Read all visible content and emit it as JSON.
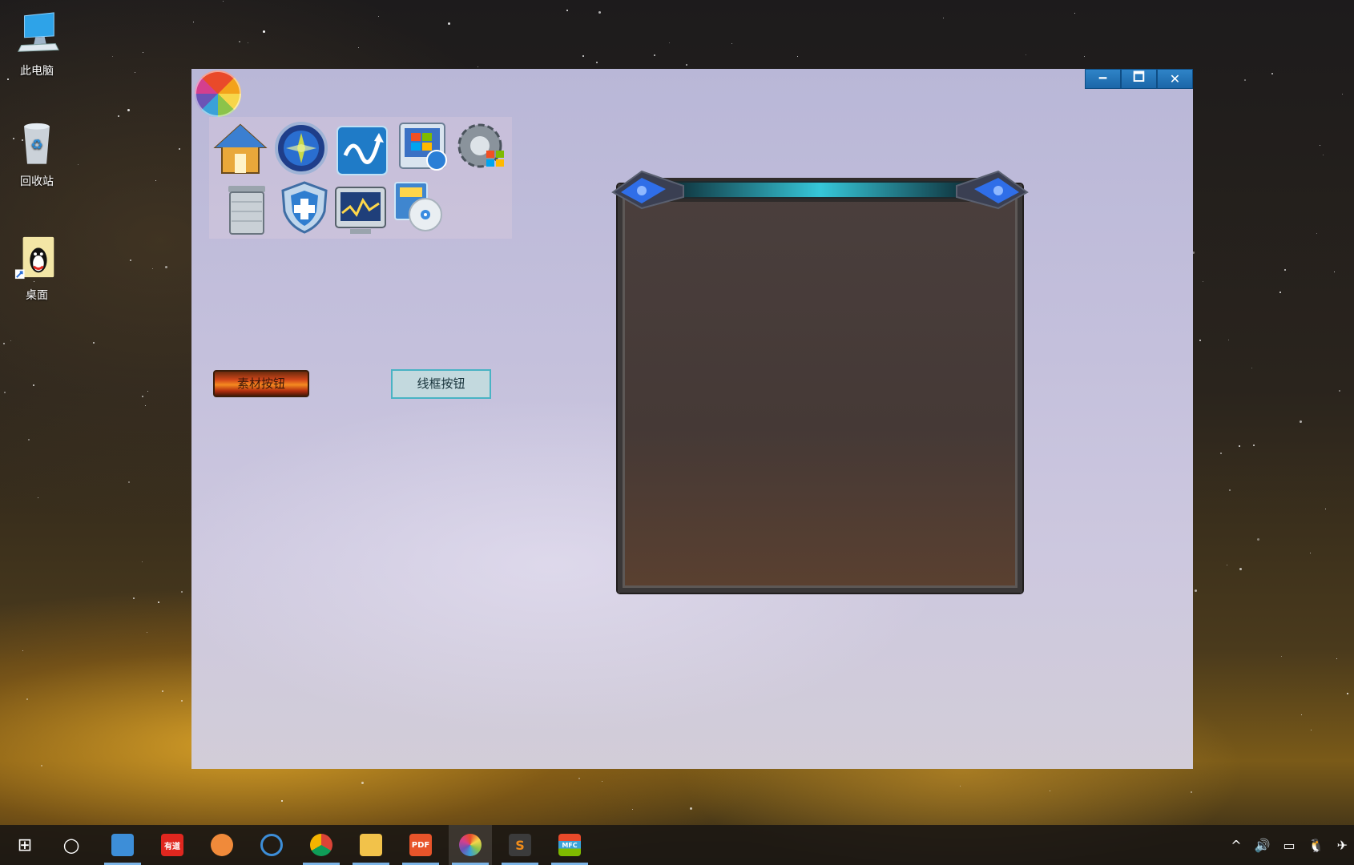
{
  "desktop": {
    "icons": [
      {
        "label": "此电脑",
        "icon": "computer-icon"
      },
      {
        "label": "回收站",
        "icon": "recycle-bin-icon"
      },
      {
        "label": "桌面",
        "icon": "qq-shortcut-icon"
      }
    ]
  },
  "window": {
    "controls": {
      "minimize": "🗕",
      "maximize": "🗖",
      "close": "✕"
    },
    "logo_icon": "pinwheel-logo-icon",
    "app_icons": [
      {
        "name": "home-icon"
      },
      {
        "name": "globe-compass-icon"
      },
      {
        "name": "sync-curve-icon"
      },
      {
        "name": "windows-update-icon"
      },
      {
        "name": "windows-settings-gear-icon"
      },
      {
        "name": "trash-can-icon"
      },
      {
        "name": "shield-plus-icon"
      },
      {
        "name": "monitor-chart-icon"
      },
      {
        "name": "disc-install-icon"
      }
    ],
    "buttons": {
      "material": "素材按钮",
      "outline": "线框按钮"
    },
    "frame": {
      "icon": "ornate-game-frame"
    }
  },
  "taskbar": {
    "items": [
      {
        "name": "start-button",
        "label": "⊞"
      },
      {
        "name": "cortana-button",
        "label": "○"
      },
      {
        "name": "taskbar-app-contacts",
        "label": ""
      },
      {
        "name": "taskbar-app-youdao",
        "label": "有道"
      },
      {
        "name": "taskbar-app-orange",
        "label": ""
      },
      {
        "name": "taskbar-app-ring",
        "label": ""
      },
      {
        "name": "taskbar-app-chrome",
        "label": ""
      },
      {
        "name": "taskbar-app-explorer",
        "label": ""
      },
      {
        "name": "taskbar-app-pdf",
        "label": "PDF"
      },
      {
        "name": "taskbar-app-colorwheel",
        "label": ""
      },
      {
        "name": "taskbar-app-sublime",
        "label": "S"
      },
      {
        "name": "taskbar-app-mfc",
        "label": "MFC"
      }
    ],
    "tray": {
      "chevron": "^",
      "volume": "🔊",
      "battery": "▭",
      "notification": "🐧",
      "airplane": "✈"
    },
    "colors": {
      "accent": "#7cb4e6",
      "youdao": "#e0271f",
      "pdf": "#e8542a",
      "sublime": "#f08c1a"
    }
  }
}
